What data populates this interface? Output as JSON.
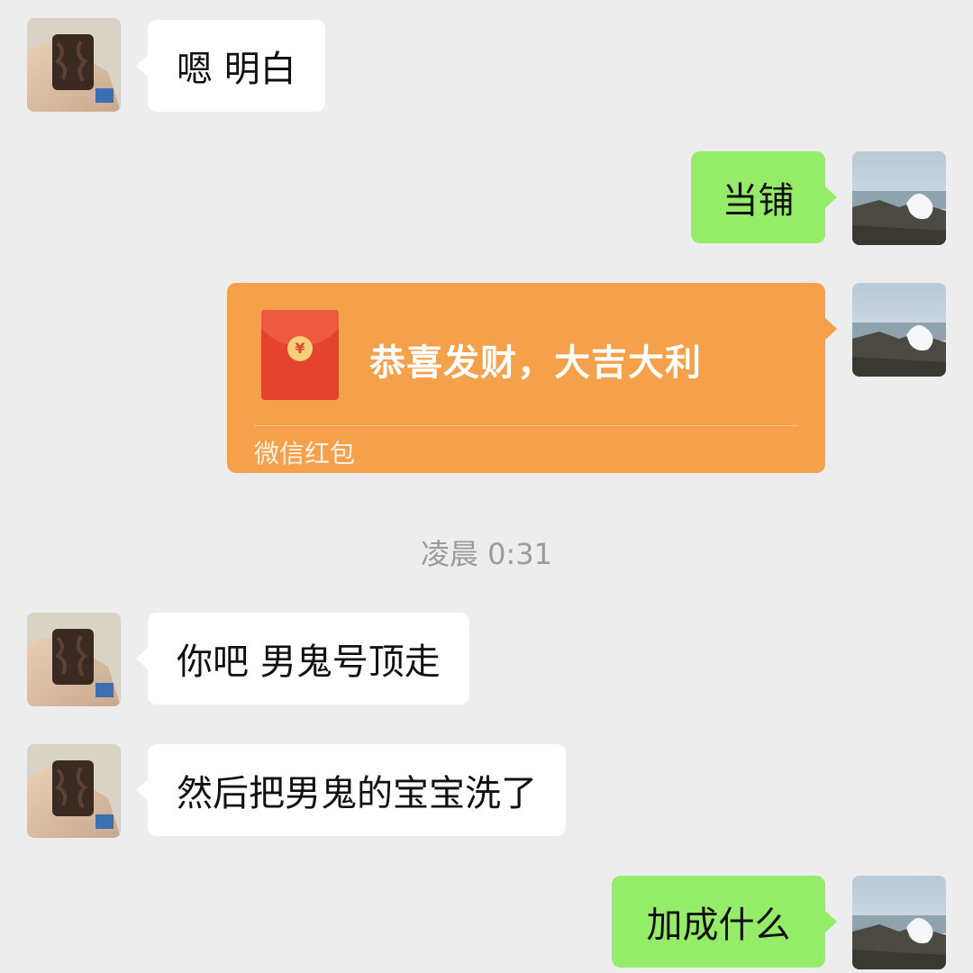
{
  "chat": {
    "messages": [
      {
        "side": "in",
        "text": "嗯 明白"
      },
      {
        "side": "out",
        "text": "当铺"
      },
      {
        "side": "out",
        "type": "red-packet",
        "title": "恭喜发财，大吉大利",
        "footer": "微信红包"
      },
      {
        "side": "in",
        "text": "你吧 男鬼号顶走"
      },
      {
        "side": "in",
        "text": "然后把男鬼的宝宝洗了"
      },
      {
        "side": "out",
        "text": "加成什么"
      }
    ],
    "timestamp": "凌晨 0:31",
    "red_packet_currency_symbol": "¥"
  },
  "colors": {
    "background": "#ededed",
    "incoming_bubble": "#ffffff",
    "outgoing_bubble": "#95ec69",
    "red_packet": "#f5a04a"
  }
}
